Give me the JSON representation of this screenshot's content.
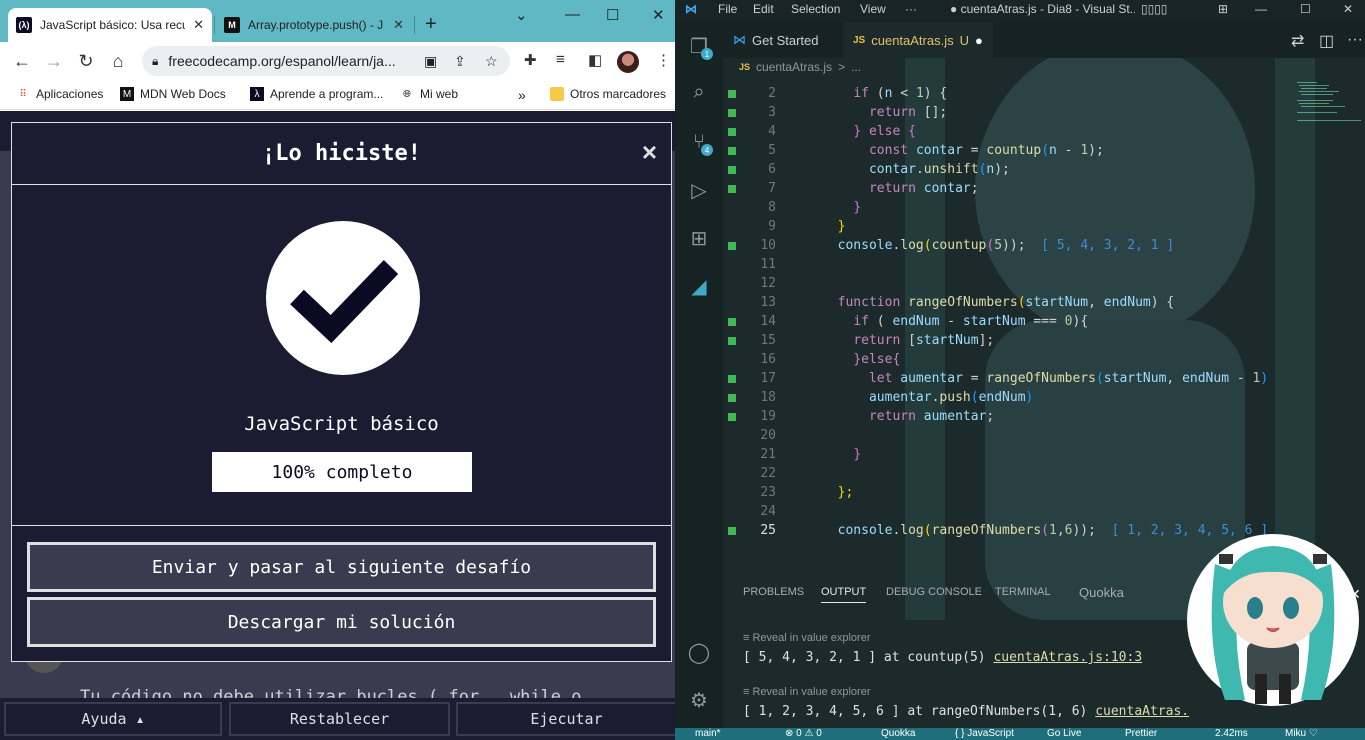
{
  "browser": {
    "tabs": [
      {
        "label": "JavaScript básico: Usa recu",
        "active": true
      },
      {
        "label": "Array.prototype.push() - J",
        "active": false
      }
    ],
    "new_tab": "+",
    "url": "freecodecamp.org/espanol/learn/ja...",
    "bookmarks": [
      {
        "label": "Aplicaciones",
        "icon": "apps-grid-icon"
      },
      {
        "label": "MDN Web Docs",
        "icon": "mdn-icon"
      },
      {
        "label": "Aprende a program...",
        "icon": "fcc-icon"
      },
      {
        "label": "Mi web",
        "icon": "globe-icon"
      }
    ],
    "bookmarks_more": "»",
    "other_bookmarks": "Otros marcadores"
  },
  "challenge": {
    "behind_text": "Tu código no debe utilizar bucles ( for , while o",
    "bottom_buttons": {
      "help": "Ayuda ▴",
      "reset": "Restablecer",
      "run": "Ejecutar"
    }
  },
  "modal": {
    "title": "¡Lo hiciste!",
    "close": "×",
    "certification": "JavaScript básico",
    "progress": "100% completo",
    "progress_percent": 100,
    "submit_button": "Enviar y pasar al siguiente desafío",
    "download_button": "Descargar mi solución"
  },
  "vscode": {
    "menu": [
      "File",
      "Edit",
      "Selection",
      "View",
      "···"
    ],
    "window_title": "● cuentaAtras.js - Dia8 - Visual St...",
    "tabs": [
      {
        "label": "Get Started"
      },
      {
        "label": "cuentaAtras.js",
        "status": "U",
        "modified": "●"
      }
    ],
    "breadcrumb": [
      "cuentaAtras.js",
      ">",
      "..."
    ],
    "lines": [
      {
        "n": "2",
        "m": true,
        "t": [
          [
            "    ",
            "op"
          ],
          [
            "if",
            "kw"
          ],
          [
            " (",
            "op"
          ],
          [
            "n",
            "va"
          ],
          [
            " < ",
            "op"
          ],
          [
            "1",
            "nu"
          ],
          [
            ") {",
            "op"
          ]
        ]
      },
      {
        "n": "3",
        "m": true,
        "t": [
          [
            "      ",
            "op"
          ],
          [
            "return",
            "kw"
          ],
          [
            " [];",
            "op"
          ]
        ]
      },
      {
        "n": "4",
        "m": true,
        "t": [
          [
            "    ",
            "op"
          ],
          [
            "}",
            "br2"
          ],
          [
            " else ",
            "kw"
          ],
          [
            "{",
            "br2"
          ]
        ]
      },
      {
        "n": "5",
        "m": true,
        "t": [
          [
            "      ",
            "op"
          ],
          [
            "const",
            "kw"
          ],
          [
            " ",
            "op"
          ],
          [
            "contar",
            "va"
          ],
          [
            " = ",
            "op"
          ],
          [
            "countup",
            "fn"
          ],
          [
            "(",
            "br3"
          ],
          [
            "n",
            "va"
          ],
          [
            " - ",
            "op"
          ],
          [
            "1",
            "nu"
          ],
          [
            ");",
            "op"
          ]
        ]
      },
      {
        "n": "6",
        "m": true,
        "t": [
          [
            "      ",
            "op"
          ],
          [
            "contar",
            "va"
          ],
          [
            ".",
            "op"
          ],
          [
            "unshift",
            "fn"
          ],
          [
            "(",
            "br3"
          ],
          [
            "n",
            "va"
          ],
          [
            ");",
            "op"
          ]
        ]
      },
      {
        "n": "7",
        "m": true,
        "t": [
          [
            "      ",
            "op"
          ],
          [
            "return",
            "kw"
          ],
          [
            " ",
            "op"
          ],
          [
            "contar",
            "va"
          ],
          [
            ";",
            "op"
          ]
        ]
      },
      {
        "n": "8",
        "m": false,
        "t": [
          [
            "    ",
            "op"
          ],
          [
            "}",
            "br2"
          ]
        ]
      },
      {
        "n": "9",
        "m": false,
        "t": [
          [
            "  ",
            "op"
          ],
          [
            "}",
            "br"
          ]
        ]
      },
      {
        "n": "10",
        "m": true,
        "t": [
          [
            "  ",
            "op"
          ],
          [
            "console",
            "va"
          ],
          [
            ".",
            "op"
          ],
          [
            "log",
            "fn"
          ],
          [
            "(",
            "br"
          ],
          [
            "countup",
            "fn"
          ],
          [
            "(",
            "br2"
          ],
          [
            "5",
            "nu"
          ],
          [
            "));",
            "op"
          ],
          [
            "  [ 5, 4, 3, 2, 1 ]",
            "inl"
          ]
        ]
      },
      {
        "n": "11",
        "m": false,
        "t": []
      },
      {
        "n": "12",
        "m": false,
        "t": []
      },
      {
        "n": "13",
        "m": false,
        "t": [
          [
            "  ",
            "op"
          ],
          [
            "function",
            "kw"
          ],
          [
            " ",
            "op"
          ],
          [
            "rangeOfNumbers",
            "fn"
          ],
          [
            "(",
            "br"
          ],
          [
            "startNum",
            "va"
          ],
          [
            ", ",
            "op"
          ],
          [
            "endNum",
            "va"
          ],
          [
            ") {",
            "op"
          ]
        ]
      },
      {
        "n": "14",
        "m": true,
        "t": [
          [
            "    ",
            "op"
          ],
          [
            "if",
            "kw"
          ],
          [
            " ( ",
            "op"
          ],
          [
            "endNum",
            "va"
          ],
          [
            " - ",
            "op"
          ],
          [
            "startNum",
            "va"
          ],
          [
            " === ",
            "op"
          ],
          [
            "0",
            "nu"
          ],
          [
            "){",
            "op"
          ]
        ]
      },
      {
        "n": "15",
        "m": true,
        "t": [
          [
            "    ",
            "op"
          ],
          [
            "return",
            "kw"
          ],
          [
            " [",
            "op"
          ],
          [
            "startNum",
            "va"
          ],
          [
            "];",
            "op"
          ]
        ]
      },
      {
        "n": "16",
        "m": false,
        "t": [
          [
            "    ",
            "op"
          ],
          [
            "}else{",
            "kw"
          ]
        ]
      },
      {
        "n": "17",
        "m": true,
        "t": [
          [
            "      ",
            "op"
          ],
          [
            "let",
            "kw"
          ],
          [
            " ",
            "op"
          ],
          [
            "aumentar",
            "va"
          ],
          [
            " = ",
            "op"
          ],
          [
            "rangeOfNumbers",
            "fn"
          ],
          [
            "(",
            "br3"
          ],
          [
            "startNum",
            "va"
          ],
          [
            ", ",
            "op"
          ],
          [
            "endNum",
            "va"
          ],
          [
            " - ",
            "op"
          ],
          [
            "1",
            "nu"
          ],
          [
            ")",
            "br3"
          ]
        ]
      },
      {
        "n": "18",
        "m": true,
        "t": [
          [
            "      ",
            "op"
          ],
          [
            "aumentar",
            "va"
          ],
          [
            ".",
            "op"
          ],
          [
            "push",
            "fn"
          ],
          [
            "(",
            "br3"
          ],
          [
            "endNum",
            "va"
          ],
          [
            ")",
            "br3"
          ]
        ]
      },
      {
        "n": "19",
        "m": true,
        "t": [
          [
            "      ",
            "op"
          ],
          [
            "return",
            "kw"
          ],
          [
            " ",
            "op"
          ],
          [
            "aumentar",
            "va"
          ],
          [
            ";",
            "op"
          ]
        ]
      },
      {
        "n": "20",
        "m": false,
        "t": []
      },
      {
        "n": "21",
        "m": false,
        "t": [
          [
            "    ",
            "op"
          ],
          [
            "}",
            "br2"
          ]
        ]
      },
      {
        "n": "22",
        "m": false,
        "t": []
      },
      {
        "n": "23",
        "m": false,
        "t": [
          [
            "  ",
            "op"
          ],
          [
            "};",
            "br"
          ]
        ]
      },
      {
        "n": "24",
        "m": false,
        "t": []
      },
      {
        "n": "25",
        "m": true,
        "t": [
          [
            "  ",
            "op"
          ],
          [
            "console",
            "va"
          ],
          [
            ".",
            "op"
          ],
          [
            "log",
            "fn"
          ],
          [
            "(",
            "br"
          ],
          [
            "rangeOfNumbers",
            "fn"
          ],
          [
            "(",
            "br2"
          ],
          [
            "1",
            "nu"
          ],
          [
            ",",
            "op"
          ],
          [
            "6",
            "nu"
          ],
          [
            "));",
            "op"
          ],
          [
            "  [ 1, 2, 3, 4, 5, 6 ]",
            "inl"
          ]
        ]
      }
    ],
    "panel_tabs": [
      "PROBLEMS",
      "OUTPUT",
      "DEBUG CONSOLE",
      "TERMINAL",
      "Quokka"
    ],
    "active_panel": "OUTPUT",
    "output": [
      {
        "hint": "Reveal in value explorer",
        "text": "[ 5, 4, 3, 2, 1 ] at countup(5) ",
        "link": "cuentaAtras.js:10:3"
      },
      {
        "hint": "Reveal in value explorer",
        "text": "[ 1, 2, 3, 4, 5, 6 ] at rangeOfNumbers(1, 6) ",
        "link": "cuentaAtras."
      }
    ],
    "status": [
      "main*",
      "⊗ 0 ⚠ 0",
      "Quokka",
      "{ } JavaScript",
      "Go Live",
      "Prettier",
      "2.42ms",
      "Miku ♡"
    ],
    "activity_badges": {
      "explorer": "1",
      "scm": "4"
    }
  }
}
